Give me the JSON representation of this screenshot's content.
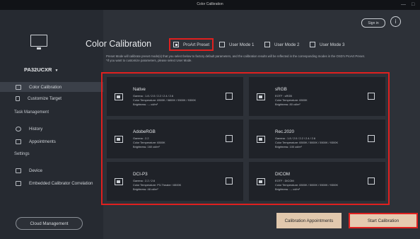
{
  "window": {
    "title": "Color Calibration",
    "min_glyph": "—",
    "max_glyph": "□"
  },
  "header": {
    "signin_label": "Sign in",
    "info_glyph": "i"
  },
  "sidebar": {
    "model": "PA32UCXR",
    "caret": "▼",
    "items": [
      {
        "label": "Color Calibration",
        "active": true
      },
      {
        "label": "Customize Target",
        "active": false
      }
    ],
    "task_section": "Task Management",
    "task_items": [
      {
        "label": "History"
      },
      {
        "label": "Appointments"
      }
    ],
    "settings_section": "Settings",
    "settings_items": [
      {
        "label": "Device"
      },
      {
        "label": "Embedded Calibrator Correlation"
      }
    ],
    "cloud_button": "Cloud Management"
  },
  "main": {
    "title": "Color Calibration",
    "modes": [
      {
        "label": "ProArt Preset",
        "checked": true
      },
      {
        "label": "User Mode 1",
        "checked": false
      },
      {
        "label": "User Mode 2",
        "checked": false
      },
      {
        "label": "User Mode 3",
        "checked": false
      }
    ],
    "description_1": "Preset Mode will calibrate preset mode(s) that you select below to factory default parameters, and the calibration results will be reflected in the corresponding modes in the OSD's ProArt Preset.",
    "description_2": "*If you want to customize parameters, please select User Mode."
  },
  "cards": [
    {
      "name": "Native",
      "lines": [
        "Gamma : 1.8 / 2.0 / 2.2 / 2.4 / 2.6",
        "Color Temperature: 6500K / 5800K / 5500K / 9300K",
        "Brightness : -- cd/m²"
      ]
    },
    {
      "name": "sRGB",
      "lines": [
        "EOTF : sRGB",
        "Color Temperature: 6500K",
        "Brightness: 80 cd/m²"
      ]
    },
    {
      "name": "AdobeRGB",
      "lines": [
        "Gamma : 2.2",
        "Color Temperature: 6500K",
        "Brightness: 160 cd/m²"
      ]
    },
    {
      "name": "Rec.2020",
      "lines": [
        "Gamma : 1.8 / 2.0 / 2.2 / 2.4 / 2.6",
        "Color Temperature: 6500K / 5000K / 5500K / 9300K",
        "Brightness: 100 cd/m²"
      ]
    },
    {
      "name": "DCI-P3",
      "lines": [
        "Gamma : 2.2 / 2.6",
        "Color Temperature: P3-Theater / 6500K",
        "Brightness: 48 cd/m²"
      ]
    },
    {
      "name": "DICOM",
      "lines": [
        "EOTF : DICOM",
        "Color Temperature: 6500K / 5000K / 5500K / 9300K",
        "Brightness : -- cd/m²"
      ]
    }
  ],
  "actions": {
    "appointments": "Calibration Appointments",
    "start": "Start Calibration"
  },
  "colors": {
    "highlight": "#e0201f",
    "accent_button": "#e1c8ad",
    "sidebar": "#262a31",
    "panel": "#2d3138",
    "card": "#1f2228"
  }
}
